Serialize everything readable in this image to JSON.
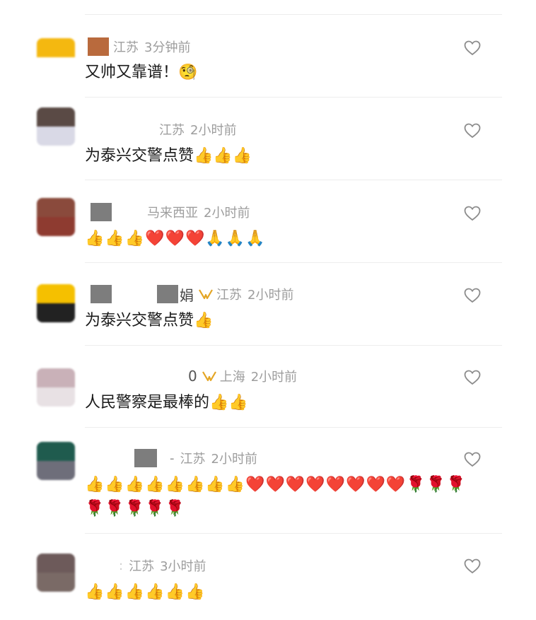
{
  "comments": [
    {
      "name": "",
      "location": "江苏",
      "time": "3分钟前",
      "text": "又帅又靠谱！🧐",
      "avatar_colors": [
        "#f4b810",
        "#ffffff"
      ]
    },
    {
      "name": "",
      "location": "江苏",
      "time": "2小时前",
      "text": "为泰兴交警点赞👍👍👍",
      "avatar_colors": [
        "#5a4a45",
        "#d9d9e6"
      ]
    },
    {
      "name": "",
      "location": "马来西亚",
      "time": "2小时前",
      "text": "👍👍👍❤️❤️❤️🙏🙏🙏",
      "avatar_colors": [
        "#8a4a3c",
        "#8e3b30"
      ]
    },
    {
      "name": "娟",
      "location": "江苏",
      "time": "2小时前",
      "text": "为泰兴交警点赞👍",
      "avatar_colors": [
        "#f5c000",
        "#222222"
      ]
    },
    {
      "name": "0",
      "location": "上海",
      "time": "2小时前",
      "text": "人民警察是最棒的👍👍",
      "avatar_colors": [
        "#c9b1b8",
        "#e8e1e4"
      ]
    },
    {
      "name": "",
      "location": "江苏",
      "time": "2小时前",
      "text_line1": "👍👍👍👍👍👍👍👍❤️❤️❤️❤️❤️❤️❤️❤️🌹🌹🌹",
      "text_line2": "🌹🌹🌹🌹🌹",
      "avatar_colors": [
        "#1f5b4e",
        "#6e6e7a"
      ]
    },
    {
      "name": "",
      "location": "江苏",
      "time": "3小时前",
      "text": "👍👍👍👍👍👍",
      "avatar_colors": [
        "#6d5a5a",
        "#7a6a66"
      ]
    }
  ],
  "icons": {
    "like": "heart-outline-icon",
    "badge": "gold-ribbon-badge-icon"
  },
  "colors": {
    "meta_gray": "#9a9a9a",
    "text": "#1a1a1a",
    "badge_gold": "#e4a524",
    "divider": "#ececec"
  }
}
